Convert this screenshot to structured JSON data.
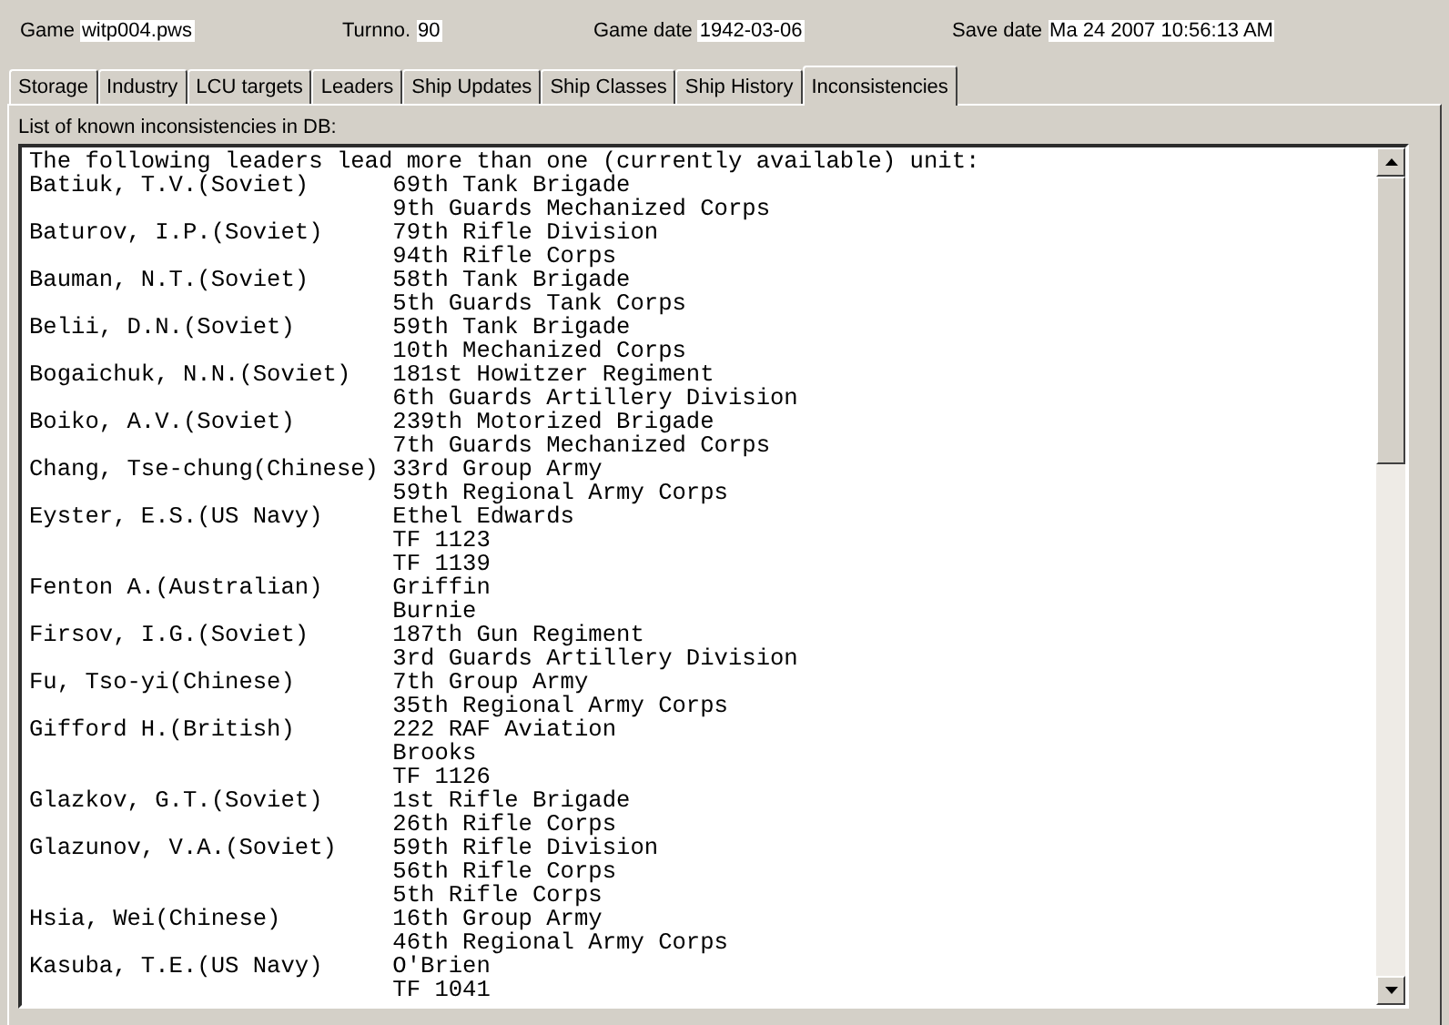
{
  "header": [
    {
      "label": "Game",
      "value": "witp004.pws"
    },
    {
      "label": "Turnno.",
      "value": "90"
    },
    {
      "label": "Game date",
      "value": "1942-03-06"
    },
    {
      "label": "Save date",
      "value": "Ma 24 2007  10:56:13 AM"
    }
  ],
  "tabs": [
    {
      "label": "Storage",
      "selected": false
    },
    {
      "label": "Industry",
      "selected": false
    },
    {
      "label": "LCU targets",
      "selected": false
    },
    {
      "label": "Leaders",
      "selected": false
    },
    {
      "label": "Ship Updates",
      "selected": false
    },
    {
      "label": "Ship Classes",
      "selected": false
    },
    {
      "label": "Ship History",
      "selected": false
    },
    {
      "label": "Inconsistencies",
      "selected": true
    }
  ],
  "panel": {
    "caption": "List of known inconsistencies in DB:",
    "intro": "The following leaders lead more than one (currently available) unit:",
    "leaders": [
      {
        "name": "Batiuk, T.V.(Soviet)",
        "units": [
          "69th Tank Brigade",
          "9th Guards Mechanized Corps"
        ]
      },
      {
        "name": "Baturov, I.P.(Soviet)",
        "units": [
          "79th Rifle Division",
          "94th Rifle Corps"
        ]
      },
      {
        "name": "Bauman, N.T.(Soviet)",
        "units": [
          "58th Tank Brigade",
          "5th Guards Tank Corps"
        ]
      },
      {
        "name": "Belii, D.N.(Soviet)",
        "units": [
          "59th Tank Brigade",
          "10th Mechanized Corps"
        ]
      },
      {
        "name": "Bogaichuk, N.N.(Soviet)",
        "units": [
          "181st Howitzer Regiment",
          "6th Guards Artillery Division"
        ]
      },
      {
        "name": "Boiko, A.V.(Soviet)",
        "units": [
          "239th Motorized Brigade",
          "7th Guards Mechanized Corps"
        ]
      },
      {
        "name": "Chang, Tse-chung(Chinese)",
        "units": [
          "33rd Group Army",
          "59th Regional Army Corps"
        ]
      },
      {
        "name": "Eyster, E.S.(US Navy)",
        "units": [
          "Ethel Edwards",
          "TF 1123",
          "TF 1139"
        ]
      },
      {
        "name": "Fenton A.(Australian)",
        "units": [
          "Griffin",
          "Burnie"
        ]
      },
      {
        "name": "Firsov, I.G.(Soviet)",
        "units": [
          "187th Gun Regiment",
          "3rd Guards Artillery Division"
        ]
      },
      {
        "name": "Fu, Tso-yi(Chinese)",
        "units": [
          "7th Group Army",
          "35th Regional Army Corps"
        ]
      },
      {
        "name": "Gifford H.(British)",
        "units": [
          "222 RAF Aviation",
          "Brooks",
          "TF 1126"
        ]
      },
      {
        "name": "Glazkov, G.T.(Soviet)",
        "units": [
          "1st Rifle Brigade",
          "26th Rifle Corps"
        ]
      },
      {
        "name": "Glazunov, V.A.(Soviet)",
        "units": [
          "59th Rifle Division",
          "56th Rifle Corps",
          "5th Rifle Corps"
        ]
      },
      {
        "name": "Hsia, Wei(Chinese)",
        "units": [
          "16th Group Army",
          "46th Regional Army Corps"
        ]
      },
      {
        "name": "Kasuba, T.E.(US Navy)",
        "units": [
          "O'Brien",
          "TF 1041"
        ]
      }
    ]
  }
}
